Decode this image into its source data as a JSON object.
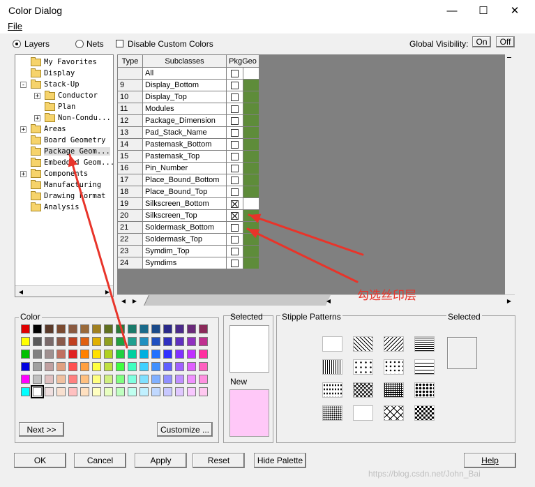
{
  "window": {
    "title": "Color Dialog",
    "minimize_icon": "minimize-icon",
    "maximize_icon": "maximize-icon",
    "close_icon": "close-icon"
  },
  "menu": {
    "file": "File"
  },
  "options": {
    "layers_label": "Layers",
    "layers_selected": true,
    "nets_label": "Nets",
    "nets_selected": false,
    "disable_custom_label": "Disable Custom Colors",
    "disable_custom_checked": false,
    "global_visibility_label": "Global Visibility:",
    "on_label": "On",
    "off_label": "Off"
  },
  "tree": [
    {
      "label": "My Favorites",
      "depth": 0,
      "expander": ""
    },
    {
      "label": "Display",
      "depth": 0,
      "expander": ""
    },
    {
      "label": "Stack-Up",
      "depth": 0,
      "expander": "-"
    },
    {
      "label": "Conductor",
      "depth": 1,
      "expander": "+"
    },
    {
      "label": "Plan",
      "depth": 1,
      "expander": ""
    },
    {
      "label": "Non-Condu...",
      "depth": 1,
      "expander": "+"
    },
    {
      "label": "Areas",
      "depth": 0,
      "expander": "+"
    },
    {
      "label": "Board Geometry",
      "depth": 0,
      "expander": ""
    },
    {
      "label": "Package Geom...",
      "depth": 0,
      "expander": "",
      "selected": true
    },
    {
      "label": "Embedded Geom...",
      "depth": 0,
      "expander": ""
    },
    {
      "label": "Components",
      "depth": 0,
      "expander": "+"
    },
    {
      "label": "Manufacturing",
      "depth": 0,
      "expander": ""
    },
    {
      "label": "Drawing Format",
      "depth": 0,
      "expander": ""
    },
    {
      "label": "Analysis",
      "depth": 0,
      "expander": ""
    }
  ],
  "grid": {
    "headers": {
      "type": "Type",
      "subclasses": "Subclasses",
      "pkggeo": "PkgGeo"
    },
    "geo_color": "#5e8c3a",
    "rows": [
      {
        "type": "",
        "name": "All",
        "checked": false
      },
      {
        "type": "9",
        "name": "Display_Bottom",
        "checked": false
      },
      {
        "type": "10",
        "name": "Display_Top",
        "checked": false
      },
      {
        "type": "11",
        "name": "Modules",
        "checked": false
      },
      {
        "type": "12",
        "name": "Package_Dimension",
        "checked": false
      },
      {
        "type": "13",
        "name": "Pad_Stack_Name",
        "checked": false
      },
      {
        "type": "14",
        "name": "Pastemask_Bottom",
        "checked": false
      },
      {
        "type": "15",
        "name": "Pastemask_Top",
        "checked": false
      },
      {
        "type": "16",
        "name": "Pin_Number",
        "checked": false
      },
      {
        "type": "17",
        "name": "Place_Bound_Bottom",
        "checked": false
      },
      {
        "type": "18",
        "name": "Place_Bound_Top",
        "checked": false
      },
      {
        "type": "19",
        "name": "Silkscreen_Bottom",
        "checked": true
      },
      {
        "type": "20",
        "name": "Silkscreen_Top",
        "checked": true
      },
      {
        "type": "21",
        "name": "Soldermask_Bottom",
        "checked": false
      },
      {
        "type": "22",
        "name": "Soldermask_Top",
        "checked": false
      },
      {
        "type": "23",
        "name": "Symdim_Top",
        "checked": false
      },
      {
        "type": "24",
        "name": "Symdims",
        "checked": false
      }
    ]
  },
  "color_section": {
    "label": "Color",
    "palette": [
      [
        "#e00000",
        "#000000",
        "#5a3a2a",
        "#7a4a30",
        "#8a5a40",
        "#9a6a3a",
        "#a08020",
        "#607020",
        "#2a7a3a",
        "#1a7a6a",
        "#1a6a8a",
        "#1a4a8a",
        "#2a2a8a",
        "#4a2a8a",
        "#6a2a7a",
        "#8a2a5a"
      ],
      [
        "#ffff00",
        "#5a5a5a",
        "#7a6a6a",
        "#8a5a4a",
        "#c04020",
        "#e06010",
        "#e0b000",
        "#90a020",
        "#20a040",
        "#20a090",
        "#2090c0",
        "#2050c0",
        "#3030c0",
        "#6030c0",
        "#9030c0",
        "#c03090"
      ],
      [
        "#00c000",
        "#808080",
        "#a09090",
        "#c07060",
        "#e02020",
        "#ff8000",
        "#ffe000",
        "#b0d020",
        "#20d040",
        "#00d0a0",
        "#00b0e0",
        "#2070ff",
        "#3030ff",
        "#8030ff",
        "#c030ff",
        "#ff30a0"
      ],
      [
        "#0000e0",
        "#a0a0a0",
        "#c0a0a0",
        "#e0a080",
        "#ff5050",
        "#ffa040",
        "#ffff40",
        "#c0e040",
        "#40ff40",
        "#40ffc0",
        "#40d0ff",
        "#4090ff",
        "#6060ff",
        "#a060ff",
        "#e060ff",
        "#ff60c0"
      ],
      [
        "#ff00ff",
        "#c0c0c0",
        "#e0c0c0",
        "#f0c0a0",
        "#ff8080",
        "#ffc080",
        "#ffff80",
        "#d0f080",
        "#80ff80",
        "#80ffe0",
        "#80e0ff",
        "#80b0ff",
        "#9090ff",
        "#c090ff",
        "#f090ff",
        "#ff90e0"
      ],
      [
        "#00ffff",
        "#ffffff",
        "#f0e0e0",
        "#f8e0d0",
        "#ffc0c0",
        "#ffe0c0",
        "#ffffc0",
        "#e8ffc0",
        "#c0ffc0",
        "#c0fff0",
        "#c0f0ff",
        "#c0d8ff",
        "#c8c8ff",
        "#e0c8ff",
        "#f8c8ff",
        "#ffc8f0"
      ]
    ],
    "next_label": "Next >>",
    "customize_label": "Customize ..."
  },
  "selected_section": {
    "label": "Selected",
    "new_label": "New",
    "selected_color": "#ffffff",
    "new_color": "#ffc8f8"
  },
  "stipple_section": {
    "label": "Stipple Patterns",
    "selected_label": "Selected"
  },
  "buttons": {
    "ok": "OK",
    "cancel": "Cancel",
    "apply": "Apply",
    "reset": "Reset",
    "hide_palette": "Hide Palette",
    "help": "Help"
  },
  "annotation": {
    "text": "勾选丝印层",
    "color": "#e8342a"
  },
  "watermark": "https://blog.csdn.net/John_Bai"
}
